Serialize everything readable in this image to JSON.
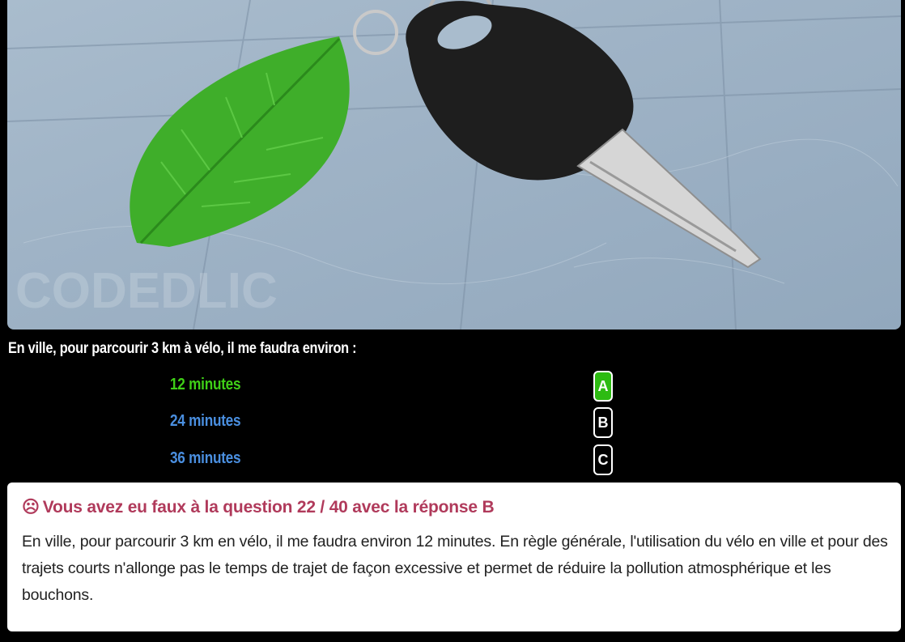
{
  "question": {
    "text": "En ville, pour parcourir 3 km à vélo, il me faudra environ :"
  },
  "answers": [
    {
      "text": "12 minutes",
      "letter": "A",
      "color": "#3fcf17",
      "state": "correct"
    },
    {
      "text": "24 minutes",
      "letter": "B",
      "color": "#4a8fe0",
      "state": "selected-wrong"
    },
    {
      "text": "36 minutes",
      "letter": "C",
      "color": "#4a8fe0",
      "state": "normal"
    }
  ],
  "feedback": {
    "icon": "frown-icon",
    "title": "Vous avez eu faux à la question 22 / 40 avec la réponse B",
    "body": "En ville, pour parcourir 3 km en vélo, il me faudra environ 12 minutes. En règle générale, l'utilisation du vélo en ville et pour des trajets courts n'allonge pas le temps de trajet de façon excessive et permet de réduire la pollution atmosphérique et les bouchons."
  },
  "photo": {
    "watermark": "CODEDLIC"
  },
  "colors": {
    "correct": "#2dbb12",
    "feedback_title": "#b03a5b",
    "background": "#000000"
  }
}
